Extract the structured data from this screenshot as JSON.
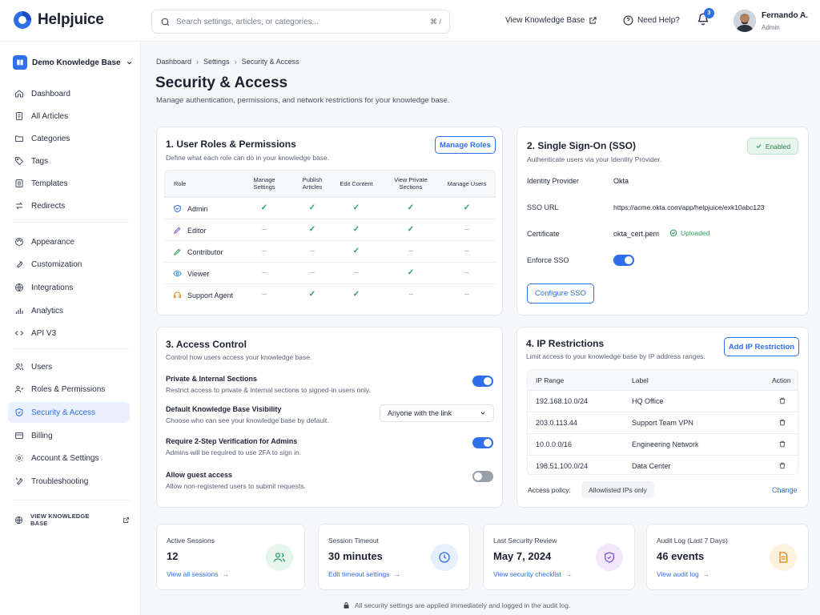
{
  "app": {
    "name": "Helpjuice"
  },
  "header": {
    "search_placeholder": "Search settings, articles, or categories...",
    "search_shortcut": "⌘ /",
    "view_kb_label": "View Knowledge Base",
    "need_help_label": "Need Help?",
    "notification_count": "3",
    "user_name": "Fernando A.",
    "user_role": "Admin"
  },
  "sidebar": {
    "kb_name": "Demo Knowledge Base",
    "group1": [
      {
        "label": "Dashboard",
        "icon": "home-icon"
      },
      {
        "label": "All Articles",
        "icon": "articles-icon"
      },
      {
        "label": "Categories",
        "icon": "folder-icon"
      },
      {
        "label": "Tags",
        "icon": "tag-icon"
      },
      {
        "label": "Templates",
        "icon": "template-icon"
      },
      {
        "label": "Redirects",
        "icon": "redirect-icon"
      }
    ],
    "group2": [
      {
        "label": "Appearance",
        "icon": "palette-icon"
      },
      {
        "label": "Customization",
        "icon": "wrench-icon"
      },
      {
        "label": "Integrations",
        "icon": "globe-icon"
      },
      {
        "label": "Analytics",
        "icon": "analytics-icon"
      },
      {
        "label": "API V3",
        "icon": "code-icon"
      }
    ],
    "group3": [
      {
        "label": "Users",
        "icon": "users-icon"
      },
      {
        "label": "Roles & Permissions",
        "icon": "roles-icon"
      },
      {
        "label": "Security & Access",
        "icon": "shield-icon",
        "active": true
      },
      {
        "label": "Billing",
        "icon": "billing-icon"
      },
      {
        "label": "Account & Settings",
        "icon": "gear-icon"
      },
      {
        "label": "Troubleshooting",
        "icon": "troubleshoot-icon"
      }
    ],
    "view_kb_label": "VIEW KNOWLEDGE BASE"
  },
  "breadcrumb": [
    "Dashboard",
    "Settings",
    "Security & Access"
  ],
  "page": {
    "title": "Security & Access",
    "subtitle": "Manage authentication, permissions, and network restrictions for your knowledge base."
  },
  "roles": {
    "title": "1. User Roles & Permissions",
    "subtitle": "Define what each role can do in your knowledge base.",
    "manage_label": "Manage Roles",
    "columns": [
      "Role",
      "Manage Settings",
      "Publish Articles",
      "Edit Content",
      "View Private Sections",
      "Manage Users"
    ],
    "rows": [
      {
        "role": "Admin",
        "icon": "shield-icon",
        "perms": [
          "✓",
          "✓",
          "✓",
          "✓",
          "✓"
        ]
      },
      {
        "role": "Editor",
        "icon": "pencil-icon",
        "perms": [
          "–",
          "✓",
          "✓",
          "✓",
          "–"
        ]
      },
      {
        "role": "Contributor",
        "icon": "pen-icon",
        "perms": [
          "–",
          "–",
          "✓",
          "–",
          "–"
        ]
      },
      {
        "role": "Viewer",
        "icon": "eye-icon",
        "perms": [
          "–",
          "–",
          "–",
          "✓",
          "–"
        ]
      },
      {
        "role": "Support Agent",
        "icon": "headset-icon",
        "perms": [
          "–",
          "✓",
          "✓",
          "–",
          "–"
        ]
      }
    ]
  },
  "sso": {
    "title": "2. Single Sign-On (SSO)",
    "subtitle": "Authenticate users via your Identity Provider.",
    "status": "Enabled",
    "idp_label": "Identity Provider",
    "idp_value": "Okta",
    "url_label": "SSO URL",
    "url_value": "https://acme.okta.com/app/helpjuice/exk10abc123",
    "cert_label": "Certificate",
    "cert_value": "okta_cert.pem",
    "cert_status": "Uploaded",
    "enforce_label": "Enforce SSO",
    "enforce_on": true,
    "configure_label": "Configure SSO"
  },
  "access": {
    "title": "3. Access Control",
    "subtitle": "Control how users access your knowledge base.",
    "private_title": "Private & Internal Sections",
    "private_desc": "Restrict access to private & internal sections to signed-in users only.",
    "visibility_title": "Default Knowledge Base Visibility",
    "visibility_desc": "Choose who can see your knowledge base by default.",
    "visibility_value": "Anyone with the link",
    "twofa_title": "Require 2-Step Verification for Admins",
    "twofa_desc": "Admins will be required to use 2FA to sign in.",
    "guest_title": "Allow guest access",
    "guest_desc": "Allow non-registered users to submit requests."
  },
  "ip": {
    "title": "4. IP Restrictions",
    "subtitle": "Limit access to your knowledge base by IP address ranges.",
    "add_label": "Add IP Restriction",
    "col_range": "IP Range",
    "col_label": "Label",
    "col_action": "Action",
    "rows": [
      {
        "range": "192.168.10.0/24",
        "label": "HQ Office"
      },
      {
        "range": "203.0.113.44",
        "label": "Support Team VPN"
      },
      {
        "range": "10.0.0.0/16",
        "label": "Engineering Network"
      },
      {
        "range": "198.51.100.0/24",
        "label": "Data Center"
      }
    ],
    "policy_label": "Access policy:",
    "policy_value": "Allowlisted IPs only",
    "change_label": "Change"
  },
  "stats": [
    {
      "label": "Active Sessions",
      "value": "12",
      "link": "View all sessions",
      "color": "#e6f6ec",
      "stroke": "#2a9d5b",
      "icon": "users-icon"
    },
    {
      "label": "Session Timeout",
      "value": "30 minutes",
      "link": "Edit timeout settings",
      "color": "#e8effc",
      "stroke": "#2f6fea",
      "icon": "clock-icon"
    },
    {
      "label": "Last Security Review",
      "value": "May 7, 2024",
      "link": "View security checklist",
      "color": "#f1e9fb",
      "stroke": "#8a4fd8",
      "icon": "shield-check-icon"
    },
    {
      "label": "Audit Log (Last 7 Days)",
      "value": "46 events",
      "link": "View audit log",
      "color": "#fdf1e0",
      "stroke": "#e08a1e",
      "icon": "document-icon"
    }
  ],
  "footer": {
    "note": "All security settings are applied immediately and logged in the audit log."
  }
}
